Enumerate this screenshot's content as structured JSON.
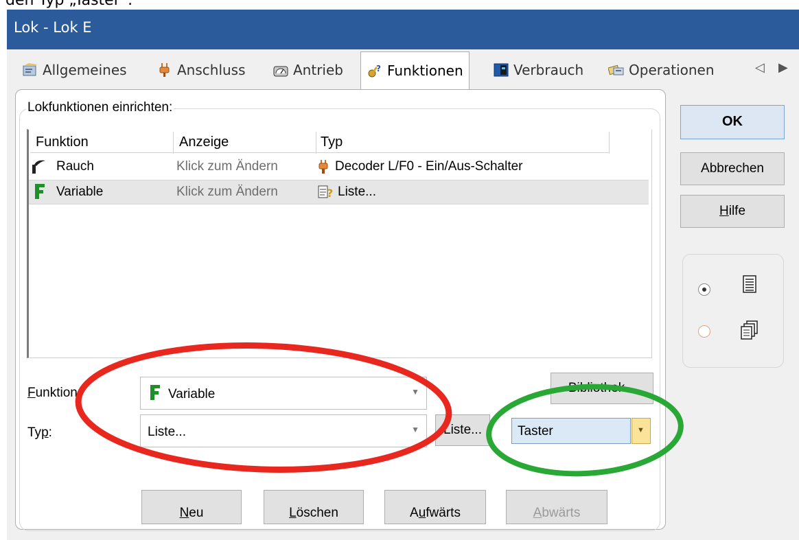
{
  "caption_fragment": "den Typ „Taster“.",
  "window": {
    "title": "Lok - Lok E"
  },
  "tabs": [
    {
      "label": "Allgemeines",
      "icon": "settings-card-icon"
    },
    {
      "label": "Anschluss",
      "icon": "plug-icon"
    },
    {
      "label": "Antrieb",
      "icon": "engine-gauge-icon"
    },
    {
      "label": "Funktionen",
      "icon": "function-key-icon",
      "active": true
    },
    {
      "label": "Verbrauch",
      "icon": "meter-icon"
    },
    {
      "label": "Operationen",
      "icon": "operations-icon"
    }
  ],
  "tab_scroll": {
    "left": "◁",
    "right": "▶"
  },
  "group": {
    "legend": "Lokfunktionen einrichten:"
  },
  "table": {
    "columns": [
      "Funktion",
      "Anzeige",
      "Typ"
    ],
    "rows": [
      {
        "funktion": "Rauch",
        "anzeige": "Klick zum Ändern",
        "typ": "Decoder L/F0 - Ein/Aus-Schalter",
        "icon": "smoke-stack-icon",
        "typ_icon": "plug-icon"
      },
      {
        "funktion": "Variable",
        "anzeige": "Klick zum Ändern",
        "typ": "Liste...",
        "icon": "f-letter-icon",
        "typ_icon": "list-question-icon",
        "selected": true
      }
    ]
  },
  "form": {
    "funktion_label_first": "F",
    "funktion_label_rest": "unktion:",
    "funktion_value": "Variable",
    "typ_label_first": "Ty",
    "typ_label_u": "p",
    "typ_label_rest": ":",
    "typ_value": "Liste...",
    "liste_button": "Liste...",
    "bibliothek_button": "Bibliothek...",
    "taster_value": "Taster"
  },
  "bottom_buttons": {
    "neu_u": "N",
    "neu_rest": "eu",
    "loeschen_u": "L",
    "loeschen_rest": "öschen",
    "aufwaerts_a": "A",
    "aufwaerts_u": "u",
    "aufwaerts_rest": "fwärts",
    "abwaerts_u": "A",
    "abwaerts_rest": "bwärts"
  },
  "side": {
    "ok": "OK",
    "abbrechen": "Abbrechen",
    "hilfe_u": "H",
    "hilfe_rest": "ilfe"
  },
  "colors": {
    "titlebar": "#2b5b9a",
    "annotation_red": "#e8281e",
    "annotation_green": "#2aa836",
    "function_green": "#1f8f2a"
  }
}
